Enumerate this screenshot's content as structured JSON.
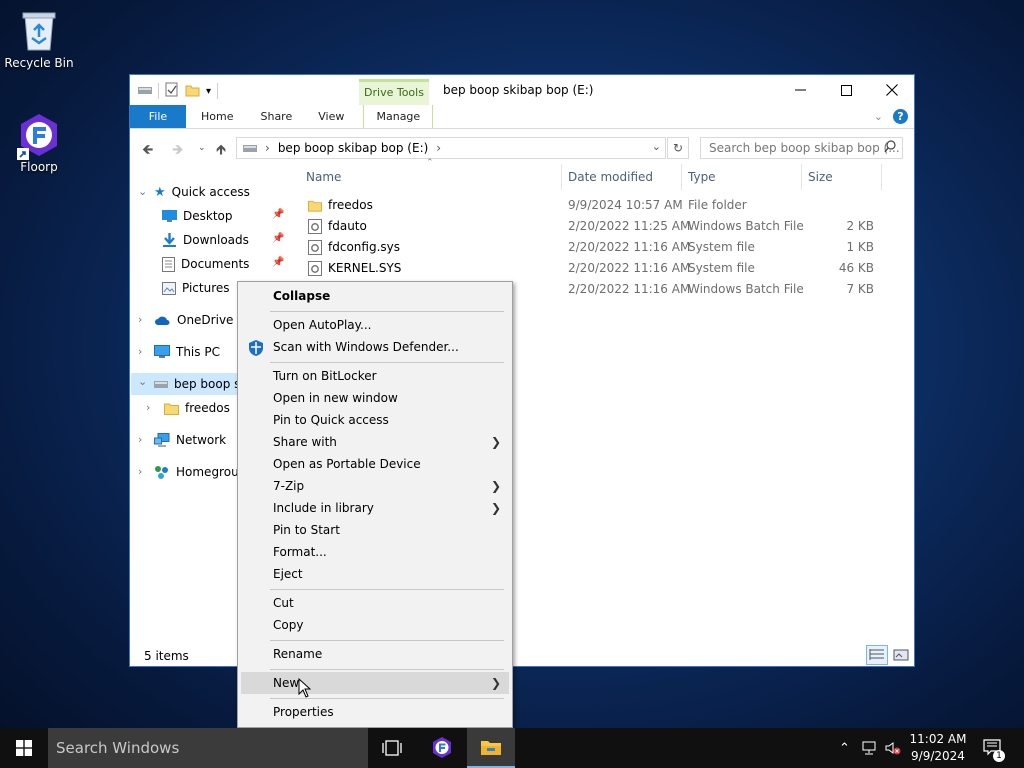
{
  "desktop": {
    "icons": [
      {
        "label": "Recycle Bin"
      },
      {
        "label": "Floorp"
      }
    ]
  },
  "window": {
    "title": "bep boop skibap bop (E:)",
    "contextual_tab_group": "Drive Tools",
    "ribbon_tabs": [
      "File",
      "Home",
      "Share",
      "View",
      "Manage"
    ],
    "help": "?",
    "address": {
      "segments": [
        "bep boop skibap bop (E:)"
      ]
    },
    "search_placeholder": "Search bep boop skibap bop (...",
    "columns": [
      "Name",
      "Date modified",
      "Type",
      "Size"
    ],
    "files": [
      {
        "name": "freedos",
        "date": "9/9/2024 10:57 AM",
        "type": "File folder",
        "size": "",
        "icon": "folder-icon"
      },
      {
        "name": "fdauto",
        "date": "2/20/2022 11:25 AM",
        "type": "Windows Batch File",
        "size": "2 KB",
        "icon": "batch-file-icon"
      },
      {
        "name": "fdconfig.sys",
        "date": "2/20/2022 11:16 AM",
        "type": "System file",
        "size": "1 KB",
        "icon": "system-file-icon"
      },
      {
        "name": "KERNEL.SYS",
        "date": "2/20/2022 11:16 AM",
        "type": "System file",
        "size": "46 KB",
        "icon": "system-file-icon"
      },
      {
        "name": "",
        "date": "2/20/2022 11:16 AM",
        "type": "Windows Batch File",
        "size": "7 KB",
        "icon": "batch-file-icon"
      }
    ],
    "nav": {
      "quick_access": "Quick access",
      "desktop": "Desktop",
      "downloads": "Downloads",
      "documents": "Documents",
      "pictures": "Pictures",
      "onedrive": "OneDrive",
      "this_pc": "This PC",
      "drive": "bep boop ski",
      "freedos": "freedos",
      "network": "Network",
      "homegroup": "Homegroup"
    },
    "status": "5 items"
  },
  "context_menu": {
    "items": [
      {
        "label": "Collapse"
      },
      {
        "label": "Open AutoPlay..."
      },
      {
        "label": "Scan with Windows Defender..."
      },
      {
        "label": "Turn on BitLocker"
      },
      {
        "label": "Open in new window"
      },
      {
        "label": "Pin to Quick access"
      },
      {
        "label": "Share with"
      },
      {
        "label": "Open as Portable Device"
      },
      {
        "label": "7-Zip"
      },
      {
        "label": "Include in library"
      },
      {
        "label": "Pin to Start"
      },
      {
        "label": "Format..."
      },
      {
        "label": "Eject"
      },
      {
        "label": "Cut"
      },
      {
        "label": "Copy"
      },
      {
        "label": "Rename"
      },
      {
        "label": "New"
      },
      {
        "label": "Properties"
      }
    ]
  },
  "taskbar": {
    "search_placeholder": "Search Windows",
    "time": "11:02 AM",
    "date": "9/9/2024",
    "notification_count": "1"
  },
  "colors": {
    "accent": "#1979ca",
    "drive_tools_tab": "#e9f5d7",
    "selection": "#cce8ff",
    "menu_highlight": "#d9d9d9",
    "taskbar": "#101010"
  }
}
